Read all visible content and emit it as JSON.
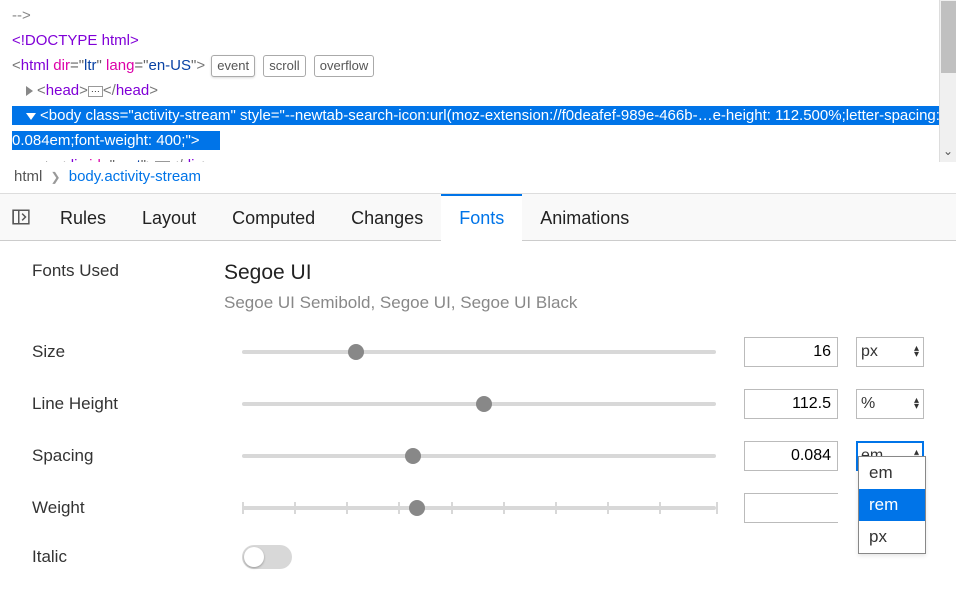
{
  "dom": {
    "comment_tail": "-->",
    "doctype": "<!DOCTYPE html>",
    "html_open": {
      "tag": "html",
      "attrs": [
        [
          "dir",
          "ltr"
        ],
        [
          "lang",
          "en-US"
        ]
      ]
    },
    "html_badges": [
      "event",
      "scroll",
      "overflow"
    ],
    "head": {
      "tag": "head"
    },
    "body": {
      "tag": "body",
      "class": "activity-stream",
      "style": "--newtab-search-icon:url(moz-extension://f0deafef-989e-466b-…e-height: 112.500%;letter-spacing: 0.084em;font-weight: 400;"
    },
    "div_root": {
      "tag": "div",
      "id": "root"
    }
  },
  "breadcrumb": [
    {
      "text": "html",
      "active": false
    },
    {
      "text": "body.activity-stream",
      "active": true
    }
  ],
  "tabs": {
    "items": [
      "Rules",
      "Layout",
      "Computed",
      "Changes",
      "Fonts",
      "Animations"
    ],
    "active": "Fonts"
  },
  "fonts": {
    "used_label": "Fonts Used",
    "primary": "Segoe UI",
    "secondary": "Segoe UI Semibold, Segoe UI, Segoe UI Black",
    "props": {
      "size": {
        "label": "Size",
        "value": "16",
        "unit": "px",
        "thumb_pct": 24
      },
      "line": {
        "label": "Line Height",
        "value": "112.5",
        "unit": "%",
        "thumb_pct": 51
      },
      "spacing": {
        "label": "Spacing",
        "value": "0.084",
        "unit": "em",
        "thumb_pct": 36,
        "unit_open": true
      },
      "weight": {
        "label": "Weight",
        "value": "",
        "unit": "",
        "thumb_pct": 37,
        "ticks": [
          0,
          11,
          22,
          33,
          44,
          55,
          66,
          77,
          88,
          100
        ]
      },
      "italic": {
        "label": "Italic",
        "on": false
      }
    },
    "unit_options": [
      "em",
      "rem",
      "px"
    ],
    "unit_highlight": "rem"
  }
}
